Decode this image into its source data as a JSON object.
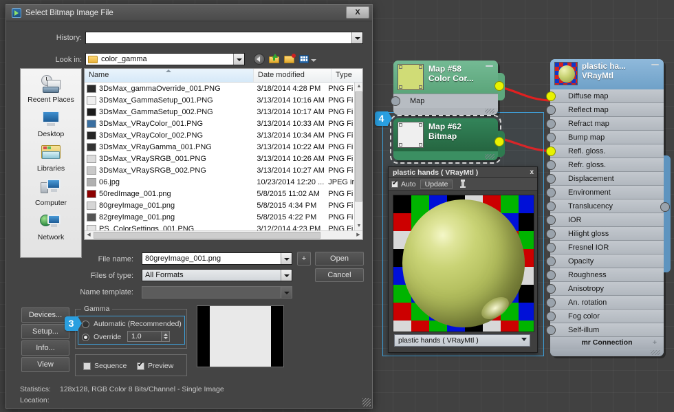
{
  "dialog": {
    "title": "Select Bitmap Image File",
    "close_label": "X",
    "history_label": "History:",
    "history_value": "",
    "lookin_label": "Look in:",
    "lookin_value": "color_gamma",
    "toolbar_icons": [
      "back-icon",
      "up-folder-icon",
      "new-folder-icon",
      "views-icon"
    ],
    "columns": [
      "Name",
      "Date modified",
      "Type"
    ],
    "files": [
      {
        "name": "3DsMax_gammaOverride_001.PNG",
        "date": "3/18/2014 4:28 PM",
        "type": "PNG Fi",
        "swatch": "#2b2b2b"
      },
      {
        "name": "3DsMax_GammaSetup_001.PNG",
        "date": "3/13/2014 10:16 AM",
        "type": "PNG Fi",
        "swatch": "#efefef"
      },
      {
        "name": "3DsMax_GammaSetup_002.PNG",
        "date": "3/13/2014 10:17 AM",
        "type": "PNG Fi",
        "swatch": "#1c1c1c"
      },
      {
        "name": "3DsMax_VRayColor_001.PNG",
        "date": "3/13/2014 10:33 AM",
        "type": "PNG Fi",
        "swatch": "#3a6fa0"
      },
      {
        "name": "3DsMax_VRayColor_002.PNG",
        "date": "3/13/2014 10:34 AM",
        "type": "PNG Fi",
        "swatch": "#252525"
      },
      {
        "name": "3DsMax_VRayGamma_001.PNG",
        "date": "3/13/2014 10:22 AM",
        "type": "PNG Fi",
        "swatch": "#333333"
      },
      {
        "name": "3DsMax_VRaySRGB_001.PNG",
        "date": "3/13/2014 10:26 AM",
        "type": "PNG Fi",
        "swatch": "#dcdcdc"
      },
      {
        "name": "3DsMax_VRaySRGB_002.PNG",
        "date": "3/13/2014 10:27 AM",
        "type": "PNG Fi",
        "swatch": "#c9c9c9"
      },
      {
        "name": "06.jpg",
        "date": "10/23/2014 12:20 ...",
        "type": "JPEG im",
        "swatch": "#b0b0b0"
      },
      {
        "name": "50redImage_001.png",
        "date": "5/8/2015 11:02 AM",
        "type": "PNG Fi",
        "swatch": "#8c0000"
      },
      {
        "name": "80greyImage_001.png",
        "date": "5/8/2015 4:34 PM",
        "type": "PNG Fi",
        "swatch": "#d6d6d6"
      },
      {
        "name": "82greyImage_001.png",
        "date": "5/8/2015 4:22 PM",
        "type": "PNG Fi",
        "swatch": "#545454"
      },
      {
        "name": "PS_ColorSettings_001.PNG",
        "date": "3/12/2014 4:23 PM",
        "type": "PNG Fi",
        "swatch": "#e4e4e4"
      }
    ],
    "filename_label": "File name:",
    "filename_value": "80greyImage_001.png",
    "plus_label": "+",
    "filetype_label": "Files of type:",
    "filetype_value": "All Formats",
    "nametemplate_label": "Name template:",
    "nametemplate_value": "",
    "open_label": "Open",
    "cancel_label": "Cancel",
    "side_buttons": [
      "Devices...",
      "Setup...",
      "Info...",
      "View"
    ],
    "gamma": {
      "group_label": "Gamma",
      "automatic_label": "Automatic (Recommended)",
      "automatic_selected": false,
      "override_label": "Override",
      "override_selected": true,
      "override_value": "1.0"
    },
    "sequence_label": "Sequence",
    "sequence_checked": false,
    "preview_label": "Preview",
    "preview_checked": true,
    "statistics_label": "Statistics:",
    "statistics_value": "128x128, RGB Color 8 Bits/Channel - Single Image",
    "location_label": "Location:",
    "location_value": "",
    "places": [
      {
        "label": "Recent Places",
        "icon": "recent-places-icon"
      },
      {
        "label": "Desktop",
        "icon": "desktop-icon"
      },
      {
        "label": "Libraries",
        "icon": "libraries-icon"
      },
      {
        "label": "Computer",
        "icon": "computer-icon"
      },
      {
        "label": "Network",
        "icon": "network-icon"
      }
    ]
  },
  "node_editor": {
    "badges": {
      "three": "3",
      "four": "4"
    },
    "nodes": [
      {
        "id": "map58",
        "title_line1": "Map #58",
        "title_line2": "Color Cor...",
        "slot": "Map",
        "header_color": "#63ad84",
        "thumb_color": "#d0dc76"
      },
      {
        "id": "map62",
        "title_line1": "Map #62",
        "title_line2": "Bitmap",
        "header_color": "#2e7a4f",
        "thumb_color": "#efefef"
      }
    ],
    "material_node": {
      "title_line1": "plastic ha...",
      "title_line2": "VRayMtl",
      "header_color": "#7ba9cd",
      "rows": [
        {
          "label": "Diffuse map",
          "connected": true
        },
        {
          "label": "Reflect map",
          "connected": false
        },
        {
          "label": "Refract map",
          "connected": false
        },
        {
          "label": "Bump map",
          "connected": false
        },
        {
          "label": "Refl. gloss.",
          "connected": true
        },
        {
          "label": "Refr. gloss.",
          "connected": false
        },
        {
          "label": "Displacement",
          "connected": false
        },
        {
          "label": "Environment",
          "connected": false
        },
        {
          "label": "Translucency",
          "connected": false
        },
        {
          "label": "IOR",
          "connected": false
        },
        {
          "label": "Hilight gloss",
          "connected": false
        },
        {
          "label": "Fresnel IOR",
          "connected": false
        },
        {
          "label": "Opacity",
          "connected": false
        },
        {
          "label": "Roughness",
          "connected": false
        },
        {
          "label": "Anisotropy",
          "connected": false
        },
        {
          "label": "An. rotation",
          "connected": false
        },
        {
          "label": "Fog color",
          "connected": false
        },
        {
          "label": "Self-illum",
          "connected": false
        }
      ],
      "footer_label": "mr Connection",
      "footer_plus": "+"
    },
    "wire_color": "#e02020"
  },
  "material_preview": {
    "title": "plastic hands  ( VRayMtl )",
    "close_label": "x",
    "auto_label": "Auto",
    "auto_checked": true,
    "update_label": "Update",
    "select_value": "plastic hands  ( VRayMtl )"
  }
}
